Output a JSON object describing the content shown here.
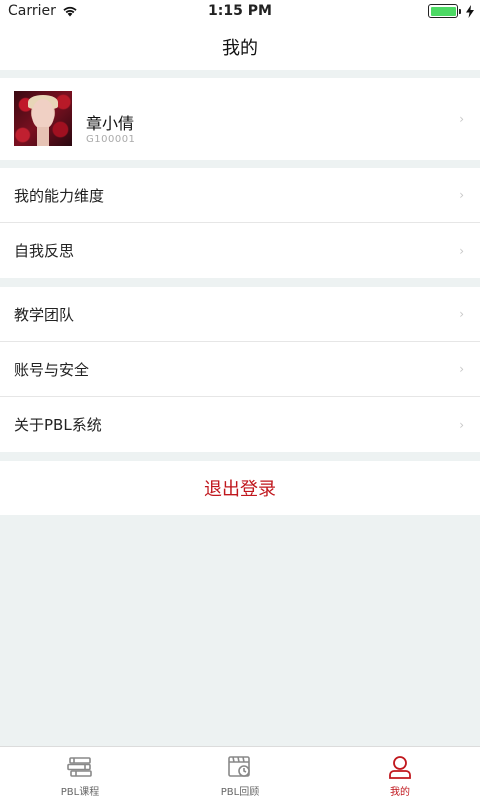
{
  "status_bar": {
    "carrier": "Carrier",
    "time": "1:15 PM",
    "battery_level": 1.0
  },
  "nav": {
    "title": "我的"
  },
  "profile": {
    "name": "章小倩",
    "id": "G100001"
  },
  "menu_group_1": [
    {
      "label": "我的能力维度"
    },
    {
      "label": "自我反思"
    }
  ],
  "menu_group_2": [
    {
      "label": "教学团队"
    },
    {
      "label": "账号与安全"
    },
    {
      "label": "关于PBL系统"
    }
  ],
  "logout": {
    "label": "退出登录"
  },
  "tabs": [
    {
      "label": "PBL课程",
      "icon": "books-icon",
      "active": false
    },
    {
      "label": "PBL回顾",
      "icon": "calendar-clock-icon",
      "active": false
    },
    {
      "label": "我的",
      "icon": "person-icon",
      "active": true
    }
  ],
  "colors": {
    "accent": "#c0171d",
    "background": "#edf2f2",
    "battery": "#4cd964"
  }
}
